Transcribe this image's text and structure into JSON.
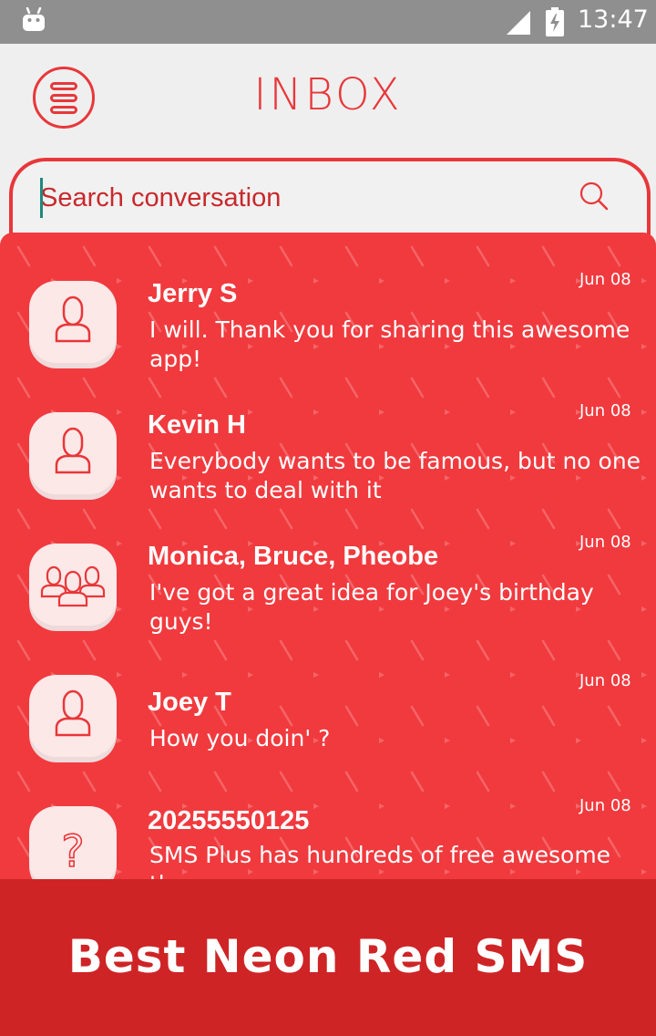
{
  "status_bar": {
    "time": "13:47",
    "icons": [
      "android-icon",
      "signal-icon",
      "battery-charging-icon"
    ]
  },
  "header": {
    "title": "INBOX",
    "menu_icon": "menu-icon"
  },
  "search": {
    "placeholder": "Search conversation",
    "icon": "search-icon"
  },
  "conversations": [
    {
      "name": "Jerry S",
      "message": "I will. Thank you for sharing this awesome app!",
      "date": "Jun 08",
      "avatar": "person-icon"
    },
    {
      "name": "Kevin H",
      "message": "Everybody wants to be famous, but no one wants to deal with it",
      "date": "Jun 08",
      "avatar": "person-icon"
    },
    {
      "name": "Monica, Bruce, Pheobe",
      "message": "I've got a great idea for Joey's birthday guys!",
      "date": "Jun 08",
      "avatar": "group-icon"
    },
    {
      "name": "Joey T",
      "message": "How you doin' ?",
      "date": "Jun 08",
      "avatar": "person-icon"
    },
    {
      "name": "20255550125",
      "message": "SMS Plus has hundreds of free awesome themes",
      "date": "Jun 08",
      "avatar": "question-mark-icon"
    }
  ],
  "banner": {
    "text": "Best Neon Red SMS"
  },
  "colors": {
    "accent": "#e8373a",
    "list_background": "#f13a3e",
    "banner_background": "#cf2426",
    "status_bar": "#8f8f8f"
  }
}
